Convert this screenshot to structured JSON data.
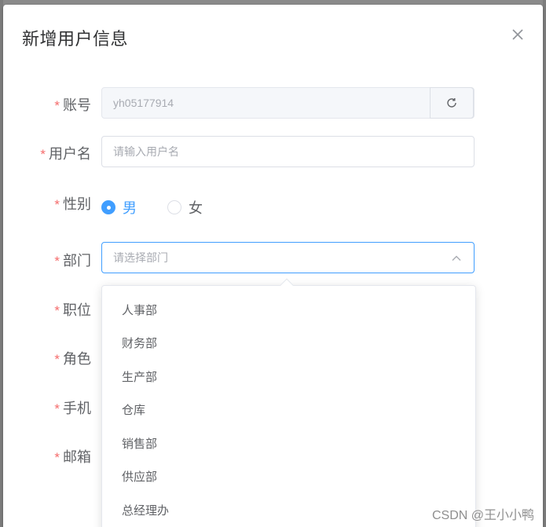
{
  "dialog": {
    "title": "新增用户信息",
    "close_icon": "close-icon"
  },
  "form": {
    "account": {
      "label": "账号",
      "value": "yh05177914",
      "refresh_icon": "refresh-icon"
    },
    "username": {
      "label": "用户名",
      "placeholder": "请输入用户名"
    },
    "gender": {
      "label": "性别",
      "options": [
        "男",
        "女"
      ],
      "selected": "男"
    },
    "department": {
      "label": "部门",
      "placeholder": "请选择部门",
      "chevron_icon": "chevron-up-icon"
    },
    "position": {
      "label": "职位"
    },
    "role": {
      "label": "角色"
    },
    "phone": {
      "label": "手机"
    },
    "email": {
      "label": "邮箱"
    },
    "required_mark": "*"
  },
  "department_dropdown": {
    "options": [
      "人事部",
      "财务部",
      "生产部",
      "仓库",
      "销售部",
      "供应部",
      "总经理办"
    ]
  },
  "watermark": "CSDN @王小小鸭",
  "colors": {
    "primary": "#409eff",
    "required": "#f56c6c",
    "text": "#606266",
    "placeholder": "#a8abb2"
  }
}
